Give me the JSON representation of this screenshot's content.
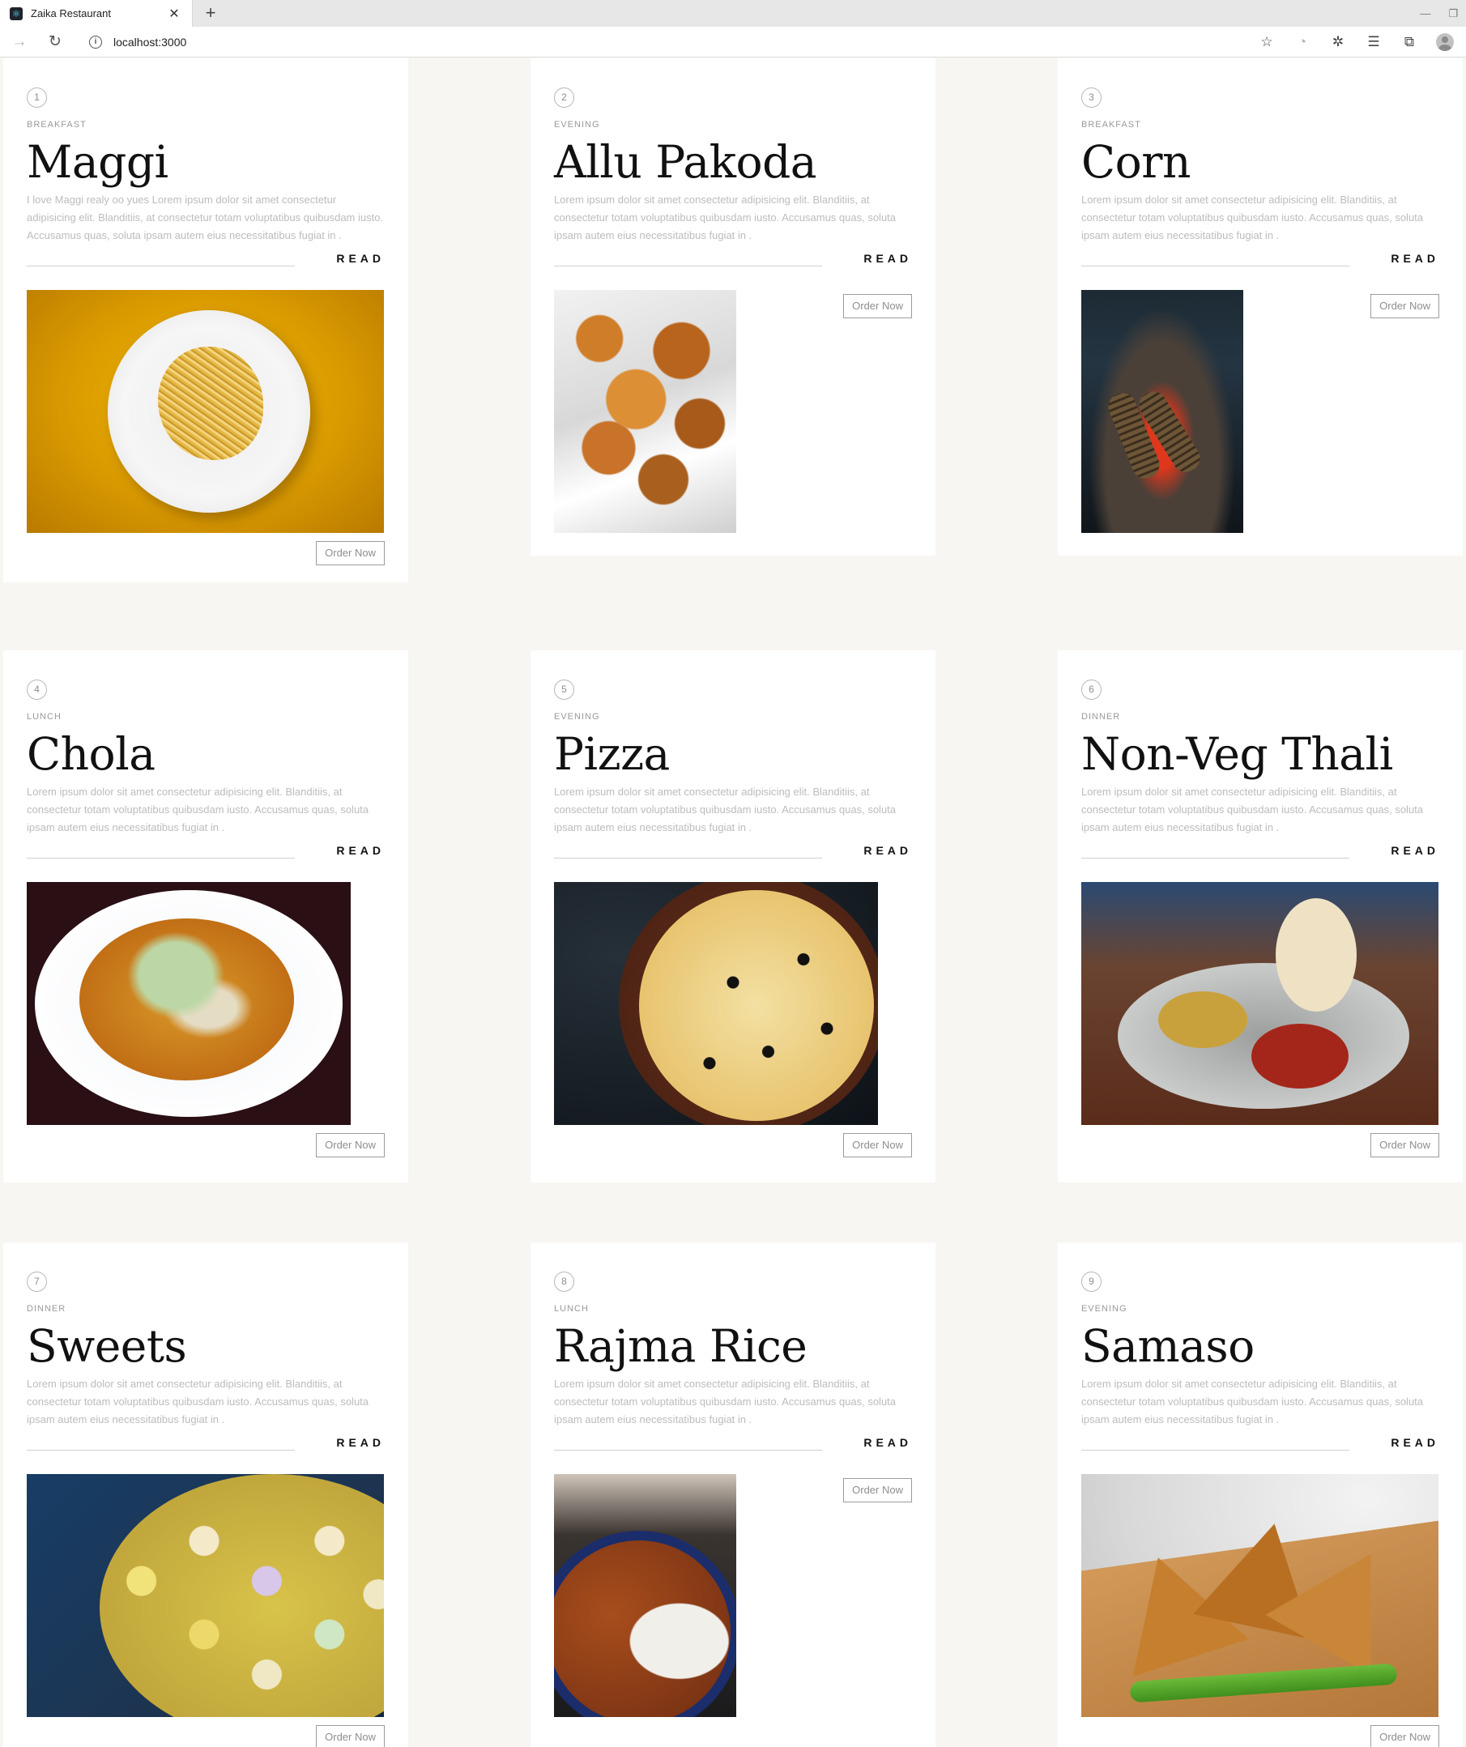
{
  "browser": {
    "tab_title": "Zaika Restaurant",
    "url": "localhost:3000"
  },
  "ui": {
    "read_label": "READ",
    "order_label": "Order Now"
  },
  "cards": [
    {
      "number": "1",
      "category": "BREAKFAST",
      "title": "Maggi",
      "description": "I love Maggi realy oo yues Lorem ipsum dolor sit amet consectetur adipisicing elit. Blanditiis, at consectetur totam voluptatibus quibusdam iusto. Accusamus quas, soluta ipsam autem eius necessitatibus fugiat in ."
    },
    {
      "number": "2",
      "category": "EVENING",
      "title": "Allu Pakoda",
      "description": "Lorem ipsum dolor sit amet consectetur adipisicing elit. Blanditiis, at consectetur totam voluptatibus quibusdam iusto. Accusamus quas, soluta ipsam autem eius necessitatibus fugiat in ."
    },
    {
      "number": "3",
      "category": "BREAKFAST",
      "title": "Corn",
      "description": "Lorem ipsum dolor sit amet consectetur adipisicing elit. Blanditiis, at consectetur totam voluptatibus quibusdam iusto. Accusamus quas, soluta ipsam autem eius necessitatibus fugiat in ."
    },
    {
      "number": "4",
      "category": "LUNCH",
      "title": "Chola",
      "description": "Lorem ipsum dolor sit amet consectetur adipisicing elit. Blanditiis, at consectetur totam voluptatibus quibusdam iusto. Accusamus quas, soluta ipsam autem eius necessitatibus fugiat in ."
    },
    {
      "number": "5",
      "category": "EVENING",
      "title": "Pizza",
      "description": "Lorem ipsum dolor sit amet consectetur adipisicing elit. Blanditiis, at consectetur totam voluptatibus quibusdam iusto. Accusamus quas, soluta ipsam autem eius necessitatibus fugiat in ."
    },
    {
      "number": "6",
      "category": "DINNER",
      "title": "Non-Veg Thali",
      "description": "Lorem ipsum dolor sit amet consectetur adipisicing elit. Blanditiis, at consectetur totam voluptatibus quibusdam iusto. Accusamus quas, soluta ipsam autem eius necessitatibus fugiat in ."
    },
    {
      "number": "7",
      "category": "DINNER",
      "title": "Sweets",
      "description": "Lorem ipsum dolor sit amet consectetur adipisicing elit. Blanditiis, at consectetur totam voluptatibus quibusdam iusto. Accusamus quas, soluta ipsam autem eius necessitatibus fugiat in ."
    },
    {
      "number": "8",
      "category": "LUNCH",
      "title": "Rajma Rice",
      "description": "Lorem ipsum dolor sit amet consectetur adipisicing elit. Blanditiis, at consectetur totam voluptatibus quibusdam iusto. Accusamus quas, soluta ipsam autem eius necessitatibus fugiat in ."
    },
    {
      "number": "9",
      "category": "EVENING",
      "title": "Samaso",
      "description": "Lorem ipsum dolor sit amet consectetur adipisicing elit. Blanditiis, at consectetur totam voluptatibus quibusdam iusto. Accusamus quas, soluta ipsam autem eius necessitatibus fugiat in ."
    }
  ]
}
